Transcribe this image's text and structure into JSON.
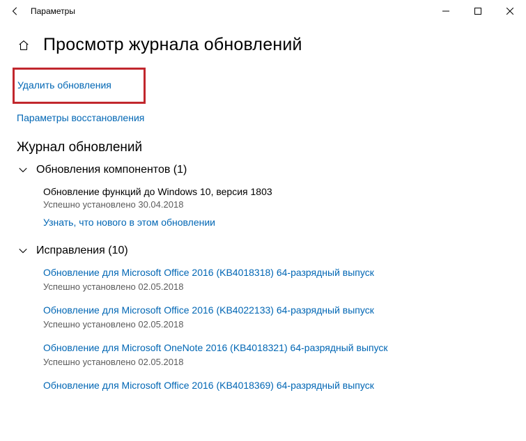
{
  "window": {
    "title": "Параметры"
  },
  "page": {
    "heading": "Просмотр журнала обновлений"
  },
  "links": {
    "uninstall": "Удалить обновления",
    "recovery": "Параметры восстановления"
  },
  "history": {
    "heading": "Журнал обновлений",
    "groups": [
      {
        "title": "Обновления компонентов (1)",
        "entries": [
          {
            "title": "Обновление функций до Windows 10, версия 1803",
            "status": "Успешно установлено 30.04.2018",
            "learn_more": "Узнать, что нового в этом обновлении",
            "title_is_link": false
          }
        ]
      },
      {
        "title": "Исправления (10)",
        "entries": [
          {
            "title": "Обновление для Microsoft Office 2016 (KB4018318) 64-разрядный выпуск",
            "status": "Успешно установлено 02.05.2018",
            "title_is_link": true
          },
          {
            "title": "Обновление для Microsoft Office 2016 (KB4022133) 64-разрядный выпуск",
            "status": "Успешно установлено 02.05.2018",
            "title_is_link": true
          },
          {
            "title": "Обновление для Microsoft OneNote 2016 (KB4018321) 64-разрядный выпуск",
            "status": "Успешно установлено 02.05.2018",
            "title_is_link": true
          },
          {
            "title": "Обновление для Microsoft Office 2016 (KB4018369) 64-разрядный выпуск",
            "status": "",
            "title_is_link": true
          }
        ]
      }
    ]
  }
}
